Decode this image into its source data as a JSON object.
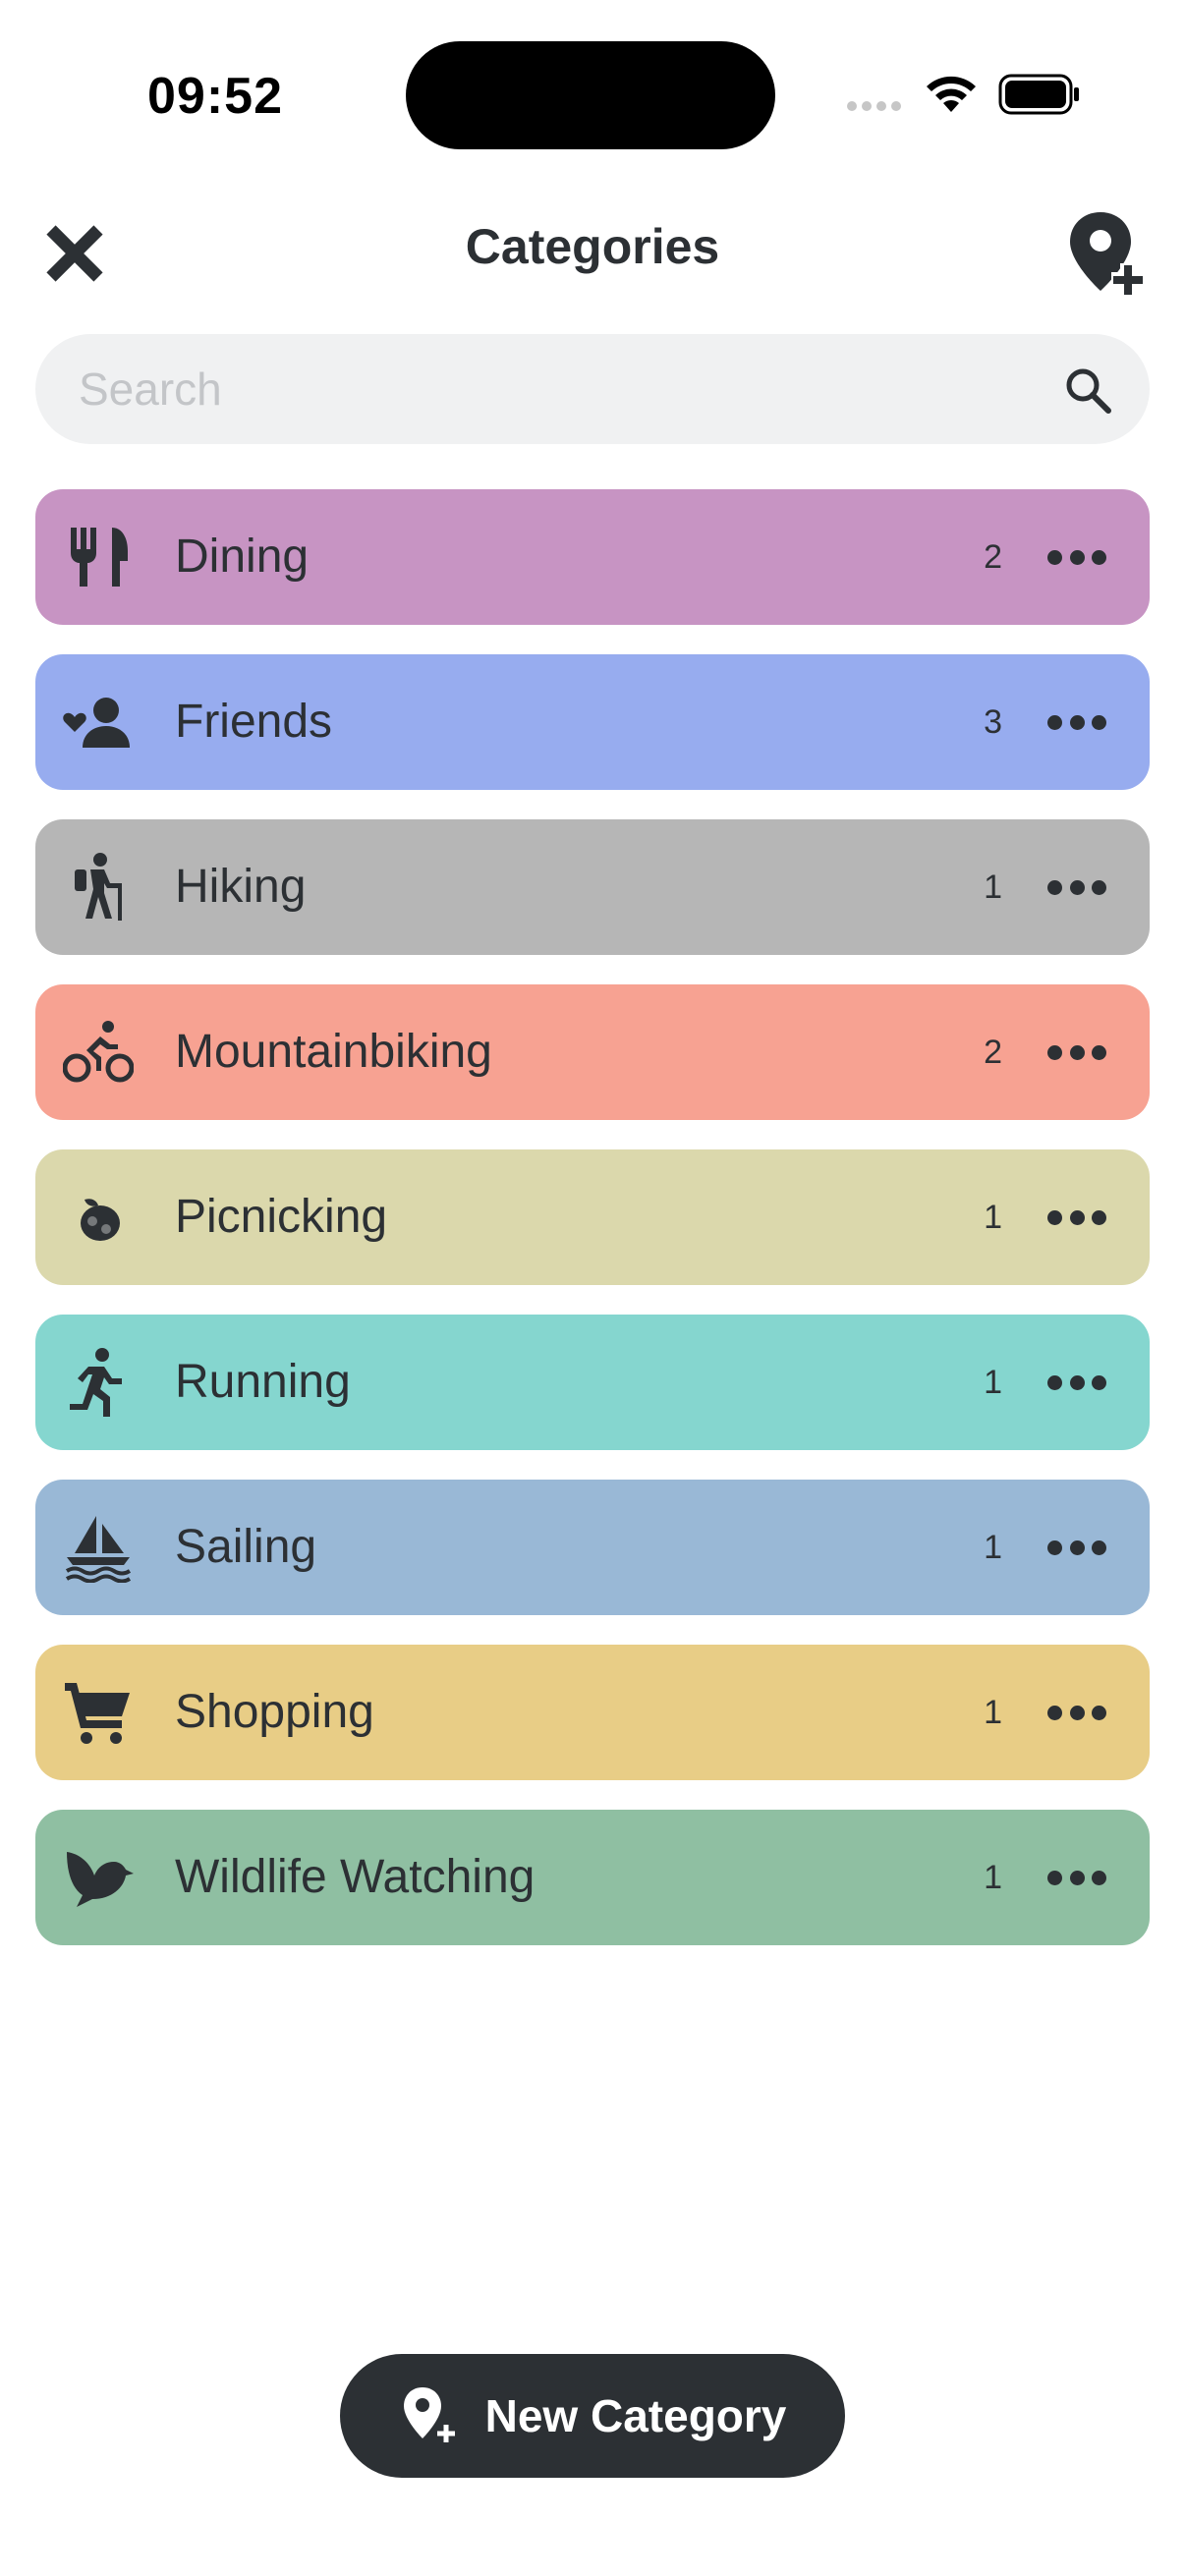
{
  "status_bar": {
    "time": "09:52"
  },
  "header": {
    "title": "Categories"
  },
  "search": {
    "placeholder": "Search",
    "value": ""
  },
  "categories": [
    {
      "label": "Dining",
      "count": "2",
      "color": "#c794c3",
      "icon": "utensils-icon"
    },
    {
      "label": "Friends",
      "count": "3",
      "color": "#97acef",
      "icon": "user-heart-icon"
    },
    {
      "label": "Hiking",
      "count": "1",
      "color": "#b6b6b6",
      "icon": "hiker-icon"
    },
    {
      "label": "Mountainbiking",
      "count": "2",
      "color": "#f7a292",
      "icon": "cyclist-icon"
    },
    {
      "label": "Picnicking",
      "count": "1",
      "color": "#dbd8ac",
      "icon": "picnic-icon"
    },
    {
      "label": "Running",
      "count": "1",
      "color": "#85d6cf",
      "icon": "runner-icon"
    },
    {
      "label": "Sailing",
      "count": "1",
      "color": "#99b8d6",
      "icon": "sailboat-icon"
    },
    {
      "label": "Shopping",
      "count": "1",
      "color": "#e8cd86",
      "icon": "cart-icon"
    },
    {
      "label": "Wildlife Watching",
      "count": "1",
      "color": "#8fbfa2",
      "icon": "bird-icon"
    }
  ],
  "footer": {
    "new_category_label": "New Category"
  },
  "colors": {
    "text": "#2c3034",
    "search_bg": "#f0f1f2",
    "button_bg": "#2c3034"
  }
}
